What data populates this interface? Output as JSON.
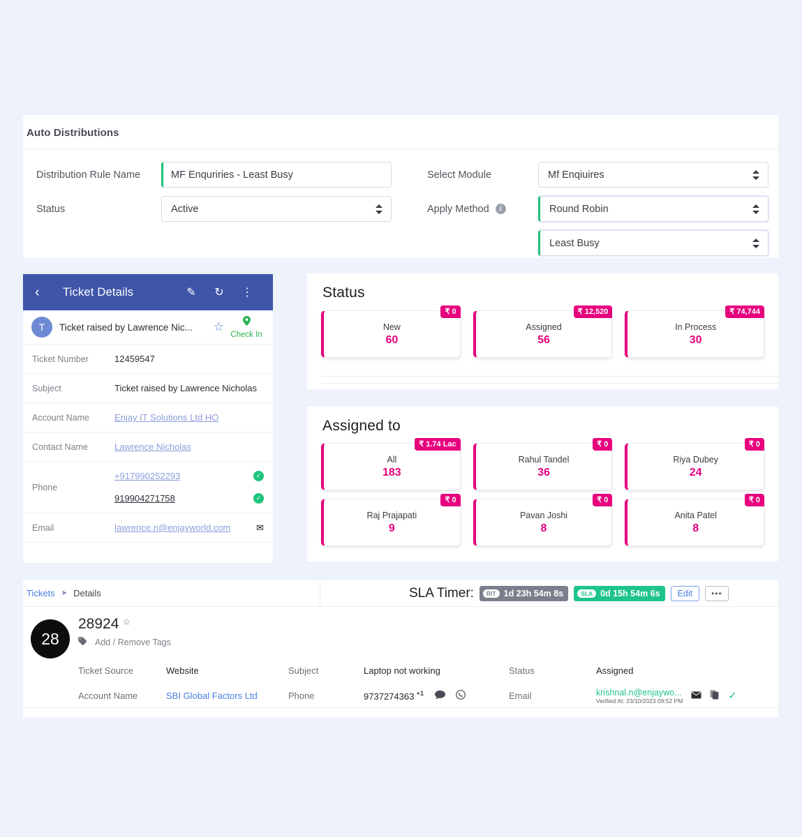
{
  "theme": {
    "page_bg": "#eef2fb",
    "accent_pink": "#e6007e",
    "header_blue": "#3e55a8",
    "green": "#1fc48a",
    "link_blue": "#4a7fe0"
  },
  "auto_distributions": {
    "title": "Auto Distributions",
    "fields": {
      "rule_name_label": "Distribution Rule Name",
      "rule_name_value": "MF Enquriries - Least Busy",
      "status_label": "Status",
      "status_value": "Active",
      "module_label": "Select Module",
      "module_value": "Mf Enqiuires",
      "apply_method_label": "Apply Method",
      "apply_method_value": "Round Robin",
      "apply_method_value_2": "Least Busy"
    },
    "icons": {
      "info": "info-icon",
      "spinner": "select-arrows-icon"
    }
  },
  "ticket_details": {
    "header": {
      "back": "‹",
      "title": "Ticket Details",
      "edit_icon": "✎",
      "refresh_icon": "↻",
      "more_icon": "⋮"
    },
    "summary": {
      "avatar_initial": "T",
      "text": "Ticket raised by Lawrence Nic...",
      "star_icon": "☆",
      "checkin_pin": "•",
      "checkin_label": "Check In"
    },
    "rows": [
      {
        "key": "Ticket Number",
        "value": "12459547",
        "style": "plain"
      },
      {
        "key": "Subject",
        "value": "Ticket raised by Lawrence Nicholas",
        "style": "plain"
      },
      {
        "key": "Account Name",
        "value": "Enjay IT Solutions Ltd HO",
        "style": "link"
      },
      {
        "key": "Contact Name",
        "value": "Lawrence Nicholas",
        "style": "link"
      }
    ],
    "phone": {
      "key": "Phone",
      "value_1": "+917990252293",
      "value_2": "919904271758",
      "verified_icon": "✓"
    },
    "email": {
      "key": "Email",
      "value": "lawrence.n@enjayworld.com",
      "mail_icon": "✉"
    }
  },
  "status_panel": {
    "title": "Status",
    "cards": [
      {
        "name": "New",
        "value": "60",
        "badge": "₹ 0"
      },
      {
        "name": "Assigned",
        "value": "56",
        "badge": "₹ 12,520"
      },
      {
        "name": "In Process",
        "value": "30",
        "badge": "₹ 74,744"
      }
    ]
  },
  "assigned_panel": {
    "title": "Assigned to",
    "row1": [
      {
        "name": "All",
        "value": "183",
        "badge": "₹ 1.74 Lac"
      },
      {
        "name": "Rahul Tandel",
        "value": "36",
        "badge": "₹ 0"
      },
      {
        "name": "Riya Dubey",
        "value": "24",
        "badge": "₹ 0"
      }
    ],
    "row2": [
      {
        "name": "Raj Prajapati",
        "value": "9",
        "badge": "₹ 0"
      },
      {
        "name": "Pavan Joshi",
        "value": "8",
        "badge": "₹ 0"
      },
      {
        "name": "Anita Patel",
        "value": "8",
        "badge": "₹ 0"
      }
    ]
  },
  "bottom_ticket": {
    "breadcrumb": {
      "root": "Tickets",
      "arrow": "➤",
      "current": "Details"
    },
    "sla": {
      "label": "SLA Timer:",
      "rit_tag": "RIT",
      "rit_value": "1d 23h 54m 8s",
      "sla_tag": "SLA",
      "sla_value": "0d 15h 54m 6s",
      "edit_button": "Edit",
      "more_button": "•••"
    },
    "avatar_number": "28",
    "ticket_id": "28924",
    "star_icon": "☆",
    "tag_icon": "⮚",
    "tags_label": "Add / Remove Tags",
    "row1": {
      "k1": "Ticket Source",
      "v1": "Website",
      "k2": "Subject",
      "v2": "Laptop not working",
      "k3": "Status",
      "v3": "Assigned"
    },
    "row2": {
      "k1": "Account Name",
      "v1": "SBI Global Factors Ltd",
      "k2": "Phone",
      "v2": "9737274363",
      "v2_sup": "+1",
      "chat_icon": "●",
      "whatsapp_icon": "◯",
      "k3": "Email",
      "email_value": "krishnal.n@enjaywo...",
      "email_verified": "Verified At: 23/10/2023 09:52 PM",
      "mail_icon": "✉",
      "copy_icon": "❐",
      "check_icon": "✓"
    }
  }
}
